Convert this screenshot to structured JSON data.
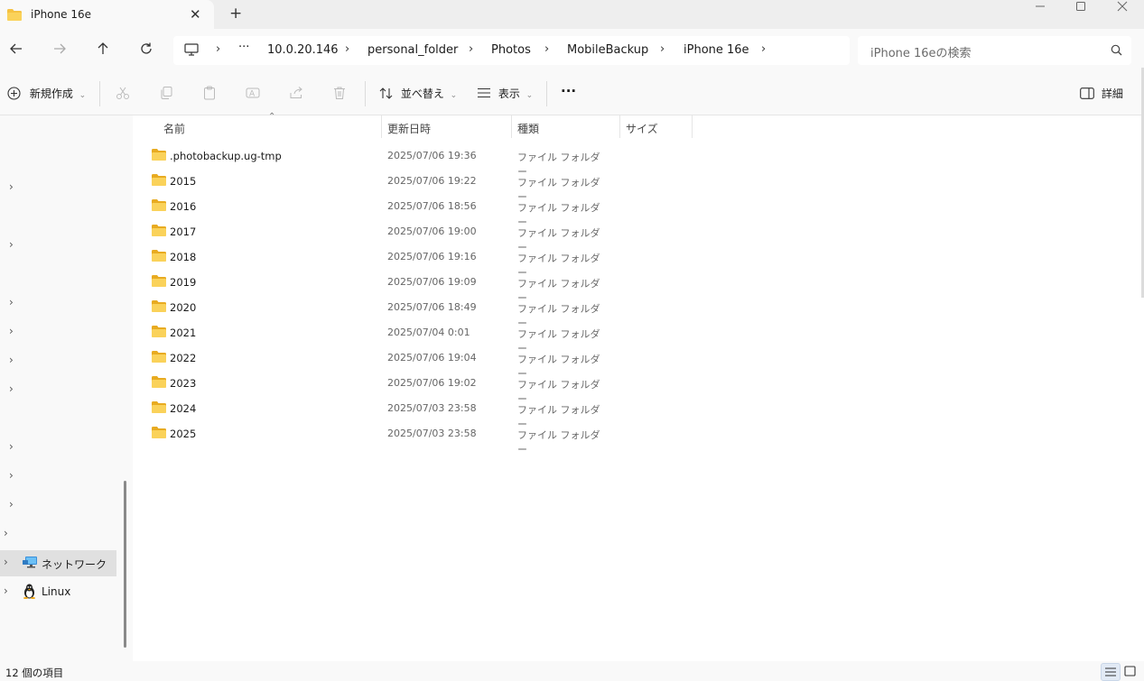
{
  "window": {
    "tab_title": "iPhone 16e",
    "new_tab": "+",
    "close_tab": "✕"
  },
  "address": {
    "path": [
      {
        "label": "10.0.20.146"
      },
      {
        "label": "personal_folder"
      },
      {
        "label": "Photos"
      },
      {
        "label": "MobileBackup"
      },
      {
        "label": "iPhone 16e"
      }
    ],
    "overflow": "···"
  },
  "search": {
    "placeholder": "iPhone 16eの検索"
  },
  "toolbar": {
    "new_label": "新規作成",
    "sort_label": "並べ替え",
    "view_label": "表示",
    "more_label": "···",
    "details_label": "詳細"
  },
  "sidebar": {
    "network_label": "ネットワーク",
    "linux_label": "Linux"
  },
  "columns": {
    "name": "名前",
    "modified": "更新日時",
    "type": "種類",
    "size": "サイズ"
  },
  "files": [
    {
      "name": ".photobackup.ug-tmp",
      "modified": "2025/07/06 19:36",
      "type": "ファイル フォルダー"
    },
    {
      "name": "2015",
      "modified": "2025/07/06 19:22",
      "type": "ファイル フォルダー"
    },
    {
      "name": "2016",
      "modified": "2025/07/06 18:56",
      "type": "ファイル フォルダー"
    },
    {
      "name": "2017",
      "modified": "2025/07/06 19:00",
      "type": "ファイル フォルダー"
    },
    {
      "name": "2018",
      "modified": "2025/07/06 19:16",
      "type": "ファイル フォルダー"
    },
    {
      "name": "2019",
      "modified": "2025/07/06 19:09",
      "type": "ファイル フォルダー"
    },
    {
      "name": "2020",
      "modified": "2025/07/06 18:49",
      "type": "ファイル フォルダー"
    },
    {
      "name": "2021",
      "modified": "2025/07/04 0:01",
      "type": "ファイル フォルダー"
    },
    {
      "name": "2022",
      "modified": "2025/07/06 19:04",
      "type": "ファイル フォルダー"
    },
    {
      "name": "2023",
      "modified": "2025/07/06 19:02",
      "type": "ファイル フォルダー"
    },
    {
      "name": "2024",
      "modified": "2025/07/03 23:58",
      "type": "ファイル フォルダー"
    },
    {
      "name": "2025",
      "modified": "2025/07/03 23:58",
      "type": "ファイル フォルダー"
    }
  ],
  "status": {
    "item_count": "12 個の項目"
  },
  "colors": {
    "folder": "#f5c242",
    "accent": "#0067c0"
  }
}
